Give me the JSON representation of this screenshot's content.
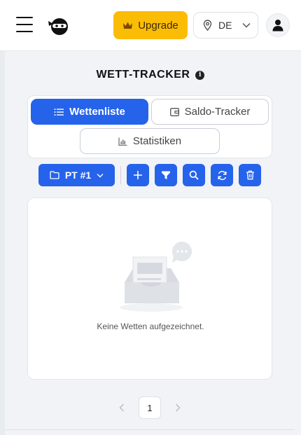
{
  "header": {
    "upgrade_label": "Upgrade",
    "language_code": "DE"
  },
  "page": {
    "title": "WETT-TRACKER"
  },
  "tabs": [
    {
      "label": "Wettenliste",
      "active": true
    },
    {
      "label": "Saldo-Tracker",
      "active": false
    },
    {
      "label": "Statistiken",
      "active": false
    }
  ],
  "toolbar": {
    "portfolio_label": "PT #1"
  },
  "empty_state": {
    "message": "Keine Wetten aufgezeichnet."
  },
  "pagination": {
    "current_page": "1"
  },
  "colors": {
    "primary": "#2563eb",
    "upgrade": "#fbbc05",
    "background": "#f1f3f6"
  }
}
